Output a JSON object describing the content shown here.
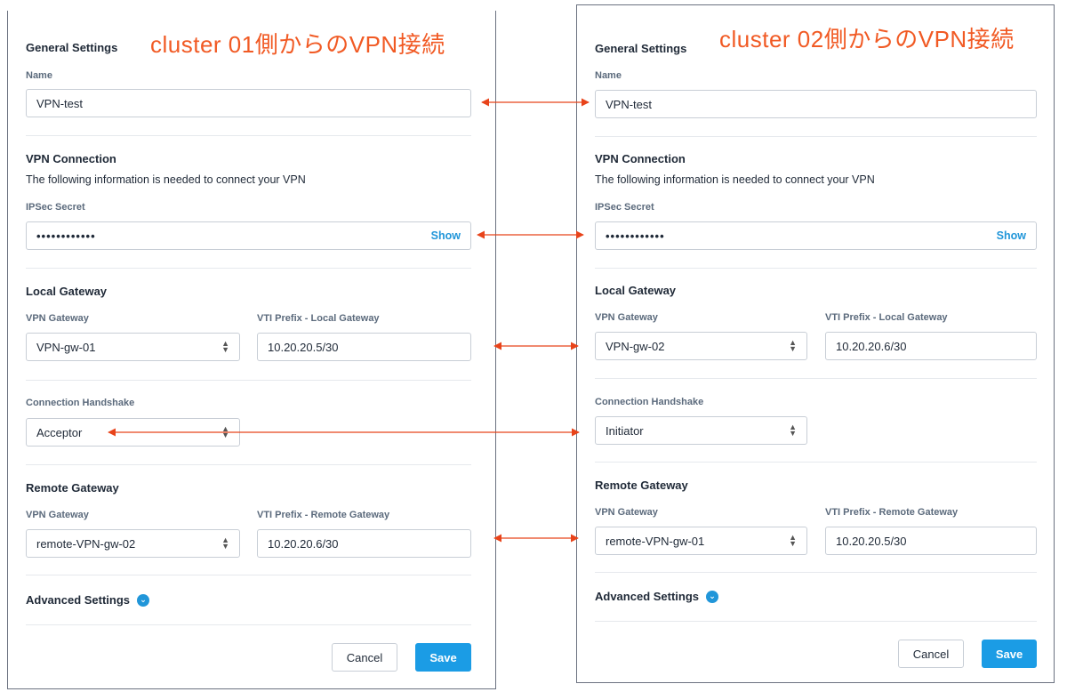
{
  "colors": {
    "accent": "#1b9ce5",
    "annotation": "#f15a24"
  },
  "left": {
    "title": "cluster 01側からのVPN接続",
    "general_settings": "General Settings",
    "name_label": "Name",
    "name_value": "VPN-test",
    "vpn_connection": "VPN Connection",
    "vpn_desc": "The following information is needed to connect your VPN",
    "ipsec_label": "IPSec Secret",
    "ipsec_value": "••••••••••••",
    "show": "Show",
    "local_gateway": "Local Gateway",
    "vpn_gateway_label": "VPN Gateway",
    "vpn_gateway_value": "VPN-gw-01",
    "vti_local_label": "VTI Prefix - Local Gateway",
    "vti_local_value": "10.20.20.5/30",
    "handshake_label": "Connection Handshake",
    "handshake_value": "Acceptor",
    "remote_gateway": "Remote Gateway",
    "remote_vpn_gateway_label": "VPN Gateway",
    "remote_vpn_gateway_value": "remote-VPN-gw-02",
    "vti_remote_label": "VTI Prefix - Remote Gateway",
    "vti_remote_value": "10.20.20.6/30",
    "advanced": "Advanced Settings",
    "cancel": "Cancel",
    "save": "Save"
  },
  "right": {
    "title": "cluster 02側からのVPN接続",
    "general_settings": "General Settings",
    "name_label": "Name",
    "name_value": "VPN-test",
    "vpn_connection": "VPN Connection",
    "vpn_desc": "The following information is needed to connect your VPN",
    "ipsec_label": "IPSec Secret",
    "ipsec_value": "••••••••••••",
    "show": "Show",
    "local_gateway": "Local Gateway",
    "vpn_gateway_label": "VPN Gateway",
    "vpn_gateway_value": "VPN-gw-02",
    "vti_local_label": "VTI Prefix - Local Gateway",
    "vti_local_value": "10.20.20.6/30",
    "handshake_label": "Connection Handshake",
    "handshake_value": "Initiator",
    "remote_gateway": "Remote Gateway",
    "remote_vpn_gateway_label": "VPN Gateway",
    "remote_vpn_gateway_value": "remote-VPN-gw-01",
    "vti_remote_label": "VTI Prefix - Remote Gateway",
    "vti_remote_value": "10.20.20.5/30",
    "advanced": "Advanced Settings",
    "cancel": "Cancel",
    "save": "Save"
  }
}
